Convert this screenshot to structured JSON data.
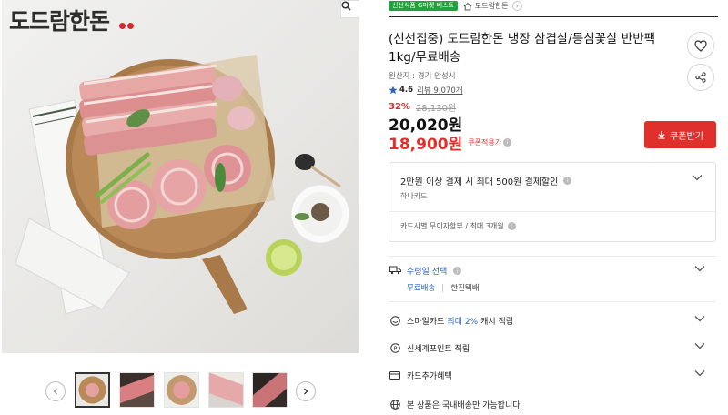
{
  "brand": {
    "name": "도드람한돈"
  },
  "gallery": {
    "thumbnail_count": 5,
    "active_thumbnail": 1
  },
  "tags": {
    "badge": "신선식품 G마켓 베스트",
    "shop_name": "도드람한돈"
  },
  "product": {
    "title": "(신선집중) 도드람한돈 냉장 삼겹살/등심꽃살 반반팩 1kg/무료배송",
    "origin": "원산지 : 경기 안성시",
    "rating": "4.6",
    "review": "리뷰 9,070개"
  },
  "price": {
    "discount_pct": "32%",
    "original": "28,130원",
    "sale": "20,020원",
    "coupon_price": "18,900원",
    "coupon_label": "쿠폰적용가",
    "coupon_button": "쿠폰받기"
  },
  "card_benefit": {
    "headline": "2만원 이상 결제 시 최대 500원 결제할인",
    "card_name": "하나카드",
    "installment": "카드사별 무이자할부 / 최대 3개월"
  },
  "shipping": {
    "label": "수령일 선택",
    "free": "무료배송",
    "carrier": "한진택배"
  },
  "options": {
    "smile_prefix": "스마일카드",
    "smile_highlight": "최대 2%",
    "smile_suffix": "캐시 적립",
    "shinsegae": "신세계포인트 적립",
    "card_extra": "카드추가혜택",
    "domestic": "본 상품은 국내배송만 가능합니다"
  },
  "colors": {
    "accent_red": "#e0302c",
    "link_blue": "#2a62c9",
    "badge_green": "#1fa33a"
  }
}
